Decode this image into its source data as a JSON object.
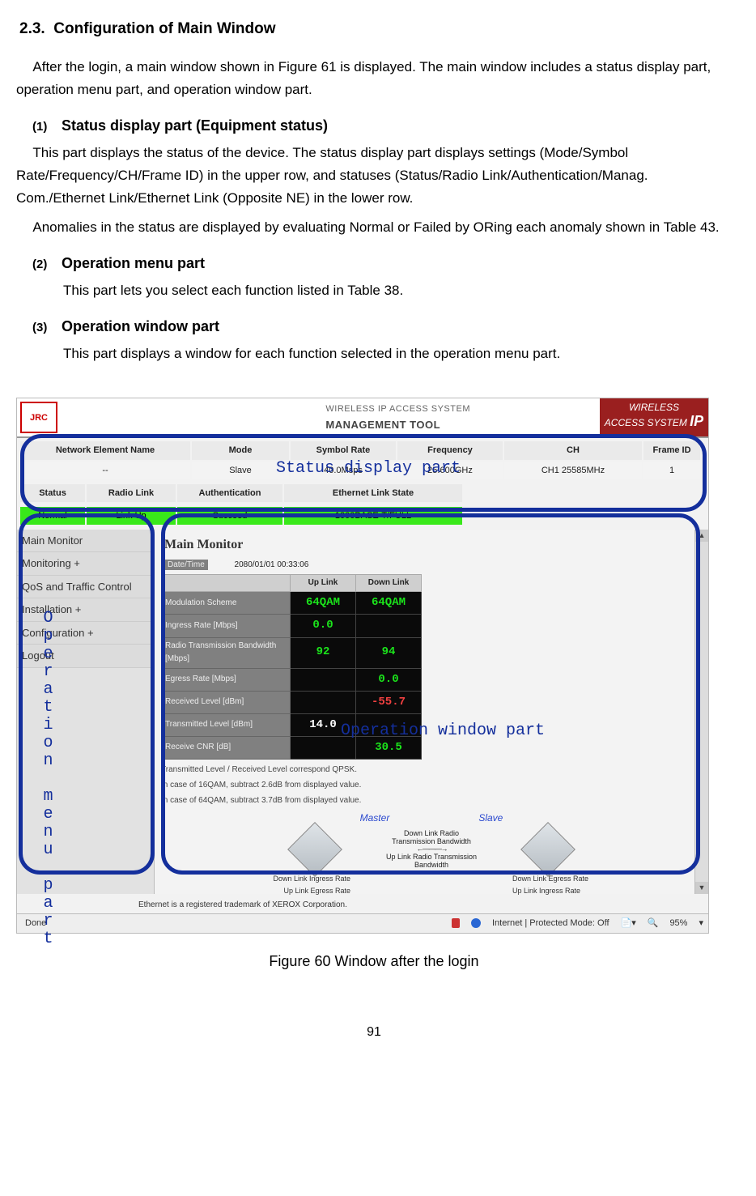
{
  "section": {
    "number": "2.3.",
    "title": "Configuration of Main Window",
    "intro": "After the login, a main window shown in Figure 61 is displayed. The main window includes a status display part, operation menu part, and operation window part."
  },
  "parts": [
    {
      "num": "(1)",
      "title": "Status display part (Equipment status)",
      "body": "This part displays the status of the device. The status display part displays settings (Mode/Symbol Rate/Frequency/CH/Frame ID) in the upper row, and statuses (Status/Radio Link/Authentication/Manag. Com./Ethernet Link/Ethernet Link (Opposite NE) in the lower row.",
      "body2": "Anomalies in the status are displayed by evaluating Normal or Failed by ORing each anomaly shown in Table 43."
    },
    {
      "num": "(2)",
      "title": "Operation menu part",
      "body": "This part lets you select each function listed in Table 38."
    },
    {
      "num": "(3)",
      "title": "Operation window part",
      "body": "This part displays a window for each function selected in the operation menu part."
    }
  ],
  "figure": {
    "logo": "JRC",
    "mt_line1": "WIRELESS IP ACCESS SYSTEM",
    "mt_line2": "MANAGEMENT TOOL",
    "brand_l1": "WIRELESS",
    "brand_l2": "ACCESS SYSTEM",
    "brand_ip": "IP",
    "status_hdr": [
      "Network Element Name",
      "Mode",
      "Symbol Rate",
      "Frequency",
      "CH",
      "Frame ID"
    ],
    "status_val": [
      "--",
      "Slave",
      "40.0Msps",
      "25.600GHz",
      "CH1  25585MHz",
      "1"
    ],
    "status2_hdr": [
      "Status",
      "Radio Link",
      "Authentication",
      "Ethernet Link State"
    ],
    "status2_val": [
      "Normal",
      "Link Up",
      "Succeed",
      "1000BASE-T/FULL"
    ],
    "menu_items": [
      "Main Monitor",
      "Monitoring +",
      "QoS and Traffic Control",
      "Installation +",
      "Configuration +",
      "Logout"
    ],
    "opwin_title": "Main Monitor",
    "datetime_label": "Date/Time",
    "datetime_value": "2080/01/01 00:33:06",
    "col_hdr": [
      "",
      "Up Link",
      "Down Link"
    ],
    "rows": [
      {
        "label": "Modulation Scheme",
        "up": "64QAM",
        "down": "64QAM",
        "cls": "green"
      },
      {
        "label": "Ingress Rate [Mbps]",
        "up": "0.0",
        "down": "",
        "cls": "green"
      },
      {
        "label": "Radio Transmission Bandwidth [Mbps]",
        "up": "92",
        "down": "94",
        "cls": "green"
      },
      {
        "label": "Egress Rate [Mbps]",
        "up": "",
        "down": "0.0",
        "cls": "green"
      },
      {
        "label": "Received Level [dBm]",
        "up": "",
        "down": "-55.7",
        "cls": "red"
      },
      {
        "label": "Transmitted Level [dBm]",
        "up": "14.0",
        "down": "",
        "cls": "white"
      },
      {
        "label": "Receive CNR [dB]",
        "up": "",
        "down": "30.5",
        "cls": "green"
      }
    ],
    "foot1": "Transmitted Level / Received Level correspond QPSK.",
    "foot2": "In case of 16QAM, subtract 2.6dB from displayed value.",
    "foot3": "In case of 64QAM, subtract 3.7dB from displayed value.",
    "ms_master": "Master",
    "ms_slave": "Slave",
    "diag_labels": {
      "dl_ingress": "Down Link Ingress Rate",
      "ul_egress_l": "Up Link Egress Rate",
      "dl_radio": "Down Link Radio Transmission Bandwidth",
      "ul_radio": "Up Link Radio Transmission Bandwidth",
      "dl_egress": "Down Link Egress Rate",
      "ul_ingress": "Up Link Ingress Rate"
    },
    "trademark": "Ethernet is a registered trademark of XEROX Corporation.",
    "statusbar": {
      "done": "Done",
      "internet": "Internet | Protected Mode: Off",
      "zoom": "95%"
    },
    "annot": {
      "status": "Status display part",
      "menu": "Operation menu part",
      "win": "Operation window part"
    },
    "caption": "Figure 60 Window after the login"
  },
  "page_number": "91"
}
